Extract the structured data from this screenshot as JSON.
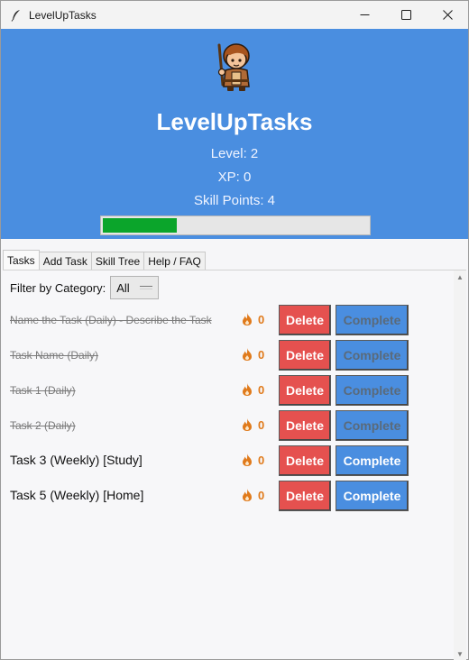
{
  "window": {
    "title": "LevelUpTasks",
    "controls": [
      "minimize",
      "maximize",
      "close"
    ]
  },
  "header": {
    "app_name": "LevelUpTasks",
    "level": "Level: 2",
    "xp": "XP: 0",
    "skill_points": "Skill Points: 4",
    "xp_progress_fraction": 0.28
  },
  "tabs": [
    {
      "label": "Tasks",
      "active": true
    },
    {
      "label": "Add Task",
      "active": false
    },
    {
      "label": "Skill Tree",
      "active": false
    },
    {
      "label": "Help / FAQ",
      "active": false
    }
  ],
  "filter": {
    "label": "Filter by Category:",
    "selected": "All"
  },
  "tasks": [
    {
      "name": "Name the Task (Daily) - Describe the Task",
      "streak": "0",
      "done": true
    },
    {
      "name": "Task Name (Daily)",
      "streak": "0",
      "done": true
    },
    {
      "name": "Task 1 (Daily)",
      "streak": "0",
      "done": true
    },
    {
      "name": "Task 2 (Daily)",
      "streak": "0",
      "done": true
    },
    {
      "name": "Task 3 (Weekly) [Study]",
      "streak": "0",
      "done": false
    },
    {
      "name": "Task 5 (Weekly) [Home]",
      "streak": "0",
      "done": false
    }
  ],
  "buttons": {
    "delete_label": "Delete",
    "complete_label": "Complete"
  },
  "colors": {
    "header_bg": "#4a8ee0",
    "delete_bg": "#e5514f",
    "complete_bg": "#4a8ee0",
    "progress_fill": "#0ba52b",
    "streak_color": "#e07a1b"
  },
  "icons": {
    "app": "feather-icon",
    "avatar": "adventurer-avatar",
    "streak": "flame-icon"
  }
}
